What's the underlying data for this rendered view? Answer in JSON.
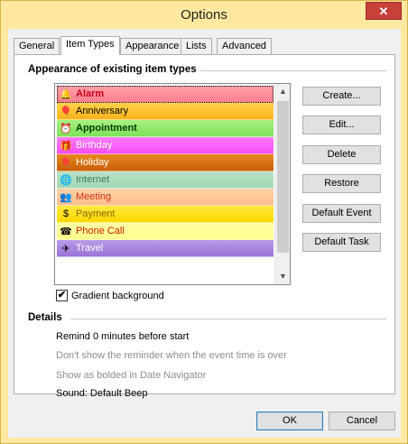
{
  "window": {
    "title": "Options",
    "close_glyph": "✕"
  },
  "tabs": [
    "General",
    "Item Types",
    "Appearance",
    "Lists",
    "Advanced"
  ],
  "appearance_section": {
    "title": "Appearance of existing item types"
  },
  "item_types": [
    {
      "label": "Alarm",
      "icon": "bell-icon",
      "glyph": "🔔",
      "bold": true,
      "bg_top": "#ffa0a8",
      "bg_bottom": "#ff7f8e",
      "color": "#c4001f"
    },
    {
      "label": "Anniversary",
      "icon": "balloons-icon",
      "glyph": "🎈",
      "bold": false,
      "bg_top": "#ffd34a",
      "bg_bottom": "#ffb11a",
      "color": "#000000"
    },
    {
      "label": "Appointment",
      "icon": "clock-icon",
      "glyph": "⏰",
      "bold": true,
      "bg_top": "#a8f080",
      "bg_bottom": "#7ee25a",
      "color": "#003d00"
    },
    {
      "label": "Birthday",
      "icon": "gift-icon",
      "glyph": "🎁",
      "bold": false,
      "bg_top": "#ff7cff",
      "bg_bottom": "#f74cf2",
      "color": "#ffffff"
    },
    {
      "label": "Holiday",
      "icon": "balloons-icon",
      "glyph": "🎈",
      "bold": false,
      "bg_top": "#e8891e",
      "bg_bottom": "#c85e08",
      "color": "#ffffff"
    },
    {
      "label": "Internet",
      "icon": "globe-icon",
      "glyph": "🌐",
      "bold": false,
      "bg_top": "#b8e4c8",
      "bg_bottom": "#a2d8b3",
      "color": "#3a7b62"
    },
    {
      "label": "Meeting",
      "icon": "people-icon",
      "glyph": "👥",
      "bold": false,
      "bg_top": "#ffd3a8",
      "bg_bottom": "#ffbe8a",
      "color": "#d0331b"
    },
    {
      "label": "Payment",
      "icon": "dollar-icon",
      "glyph": "$",
      "bold": false,
      "bg_top": "#ffea40",
      "bg_bottom": "#ffd800",
      "color": "#8a6500"
    },
    {
      "label": "Phone Call",
      "icon": "phone-icon",
      "glyph": "☎",
      "bold": false,
      "bg_top": "#ffffa8",
      "bg_bottom": "#ffff88",
      "color": "#cc1b00"
    },
    {
      "label": "Travel",
      "icon": "airplane-icon",
      "glyph": "✈",
      "bold": false,
      "bg_top": "#b99be8",
      "bg_bottom": "#9a73d8",
      "color": "#ffffff"
    }
  ],
  "buttons": {
    "create": "Create...",
    "edit": "Edit...",
    "delete": "Delete",
    "restore": "Restore",
    "default_event": "Default Event",
    "default_task": "Default Task"
  },
  "gradient_checkbox": {
    "label": "Gradient background",
    "checked": true,
    "check_glyph": "✔"
  },
  "details": {
    "title": "Details",
    "remind": "Remind  0 minutes before start",
    "dont_show": "Don't show the reminder when the event time is over",
    "show_bolded": "Show as bolded in Date Navigator",
    "sound": "Sound:  Default Beep"
  },
  "dialog_buttons": {
    "ok": "OK",
    "cancel": "Cancel"
  },
  "scrollbar": {
    "up_glyph": "▲",
    "down_glyph": "▼"
  }
}
